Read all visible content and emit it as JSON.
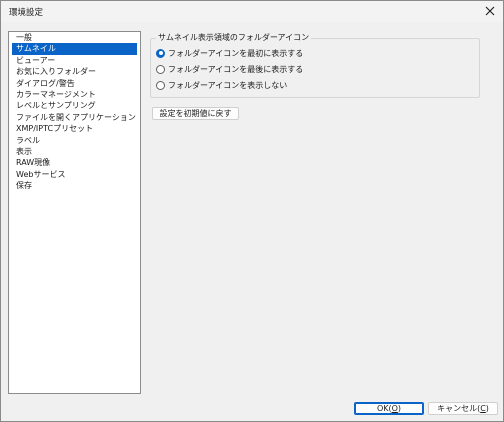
{
  "window": {
    "title": "環境設定"
  },
  "sidebar": {
    "items": [
      {
        "label": "一般"
      },
      {
        "label": "サムネイル"
      },
      {
        "label": "ビューアー"
      },
      {
        "label": "お気に入りフォルダー"
      },
      {
        "label": "ダイアログ/警告"
      },
      {
        "label": "カラーマネージメント"
      },
      {
        "label": "レベルとサンプリング"
      },
      {
        "label": "ファイルを開くアプリケーション"
      },
      {
        "label": "XMP/IPTCプリセット"
      },
      {
        "label": "ラベル"
      },
      {
        "label": "表示"
      },
      {
        "label": "RAW現像"
      },
      {
        "label": "Webサービス"
      },
      {
        "label": "保存"
      }
    ],
    "selected_index": 1
  },
  "thumbnail_settings": {
    "group_title": "サムネイル表示領域のフォルダーアイコン",
    "options": [
      {
        "label": "フォルダーアイコンを最初に表示する",
        "checked": true
      },
      {
        "label": "フォルダーアイコンを最後に表示する",
        "checked": false
      },
      {
        "label": "フォルダーアイコンを表示しない",
        "checked": false
      }
    ],
    "reset_button": "設定を初期値に戻す"
  },
  "footer": {
    "ok_label": "OK(",
    "ok_mnemonic": "O",
    "ok_suffix": ")",
    "cancel_label": "キャンセル(",
    "cancel_mnemonic": "C",
    "cancel_suffix": ")"
  },
  "colors": {
    "accent": "#0a64c8",
    "window_bg": "#f0f0f0"
  },
  "icons": {
    "close": "close-icon"
  }
}
